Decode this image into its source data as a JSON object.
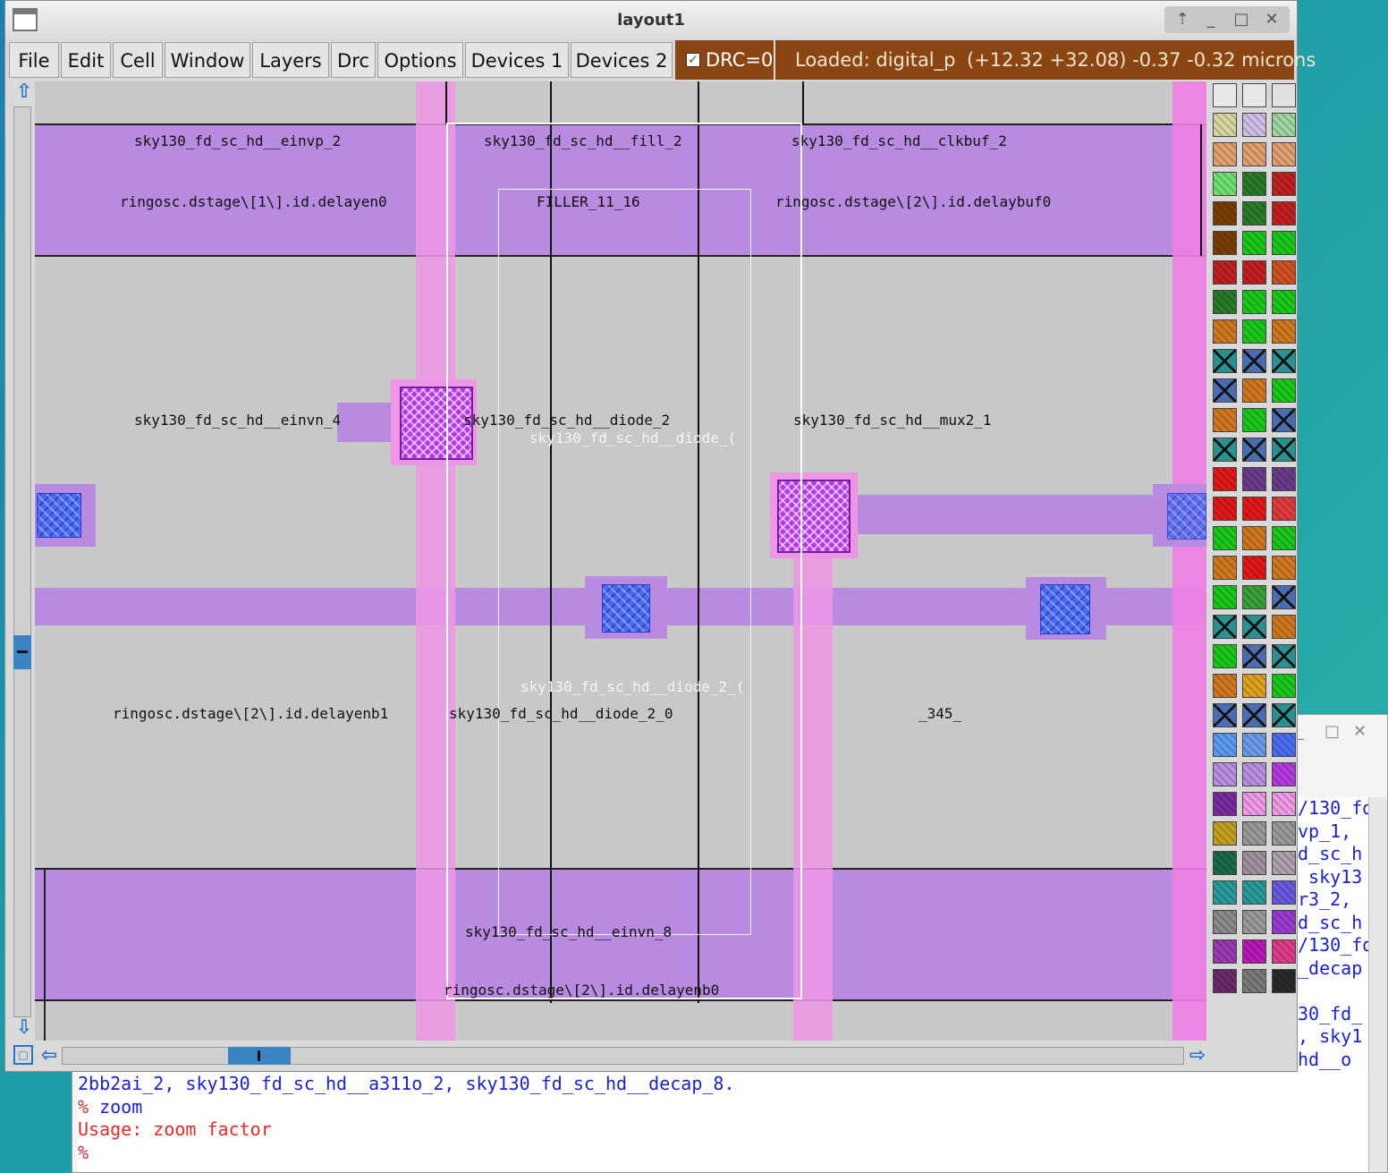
{
  "window": {
    "title": "layout1"
  },
  "menu": [
    "File",
    "Edit",
    "Cell",
    "Window",
    "Layers",
    "Drc",
    "Options",
    "Devices 1",
    "Devices 2"
  ],
  "drc": {
    "label": "DRC=0",
    "checked": true
  },
  "status": {
    "loaded": "Loaded: digital_p",
    "coords": "(+12.32 +32.08) -0.37 -0.32 microns"
  },
  "cells": [
    "sky130_fd_sc_hd__einvp_2",
    "sky130_fd_sc_hd__fill_2",
    "sky130_fd_sc_hd__clkbuf_2",
    "ringosc.dstage\\[1\\].id.delayen0",
    "FILLER_11_16",
    "ringosc.dstage\\[2\\].id.delaybuf0",
    "sky130_fd_sc_hd__einvn_4",
    "sky130_fd_sc_hd__diode_2",
    "sky130_fd_sc_hd__mux2_1",
    "ringosc.dstage\\[2\\].id.delayenb1",
    "sky130_fd_sc_hd__diode_2_0",
    "_345_",
    "sky130_fd_sc_hd__einvn_8",
    "ringosc.dstage\\[2\\].id.delayenb0"
  ],
  "cells_faint": [
    "sky130_fd_sc_hd__diode_(",
    "sky130_fd_sc_hd__diode_2_("
  ],
  "console": {
    "lines": [
      {
        "text": "2bb2ai_2, sky130_fd_sc_hd__a311o_2, sky130_fd_sc_hd__decap_8.",
        "type": "output"
      },
      {
        "prompt": "%",
        "text": " zoom",
        "type": "command"
      },
      {
        "text": "Usage: zoom factor",
        "type": "error"
      },
      {
        "prompt": "%",
        "text": "",
        "type": "command"
      }
    ],
    "side_lines": [
      "/130_fd",
      "vp_1,",
      "d_sc_h",
      " sky13",
      "r3_2,",
      "d_sc_h",
      "/130_fd",
      "_decap",
      "",
      "30_fd_",
      ", sky1",
      "hd__o"
    ]
  },
  "palette_colors": {
    "rows": [
      [
        "#e8e8e8",
        "#e8e8e8",
        "#e0e0e0"
      ],
      [
        "#d6d6a0",
        "#d0c0e8",
        "#9ed89e"
      ],
      [
        "#e0a070",
        "#e0a070",
        "#e0a070"
      ],
      [
        "#6fe06f",
        "#2a7a2a",
        "#c02020"
      ],
      [
        "#7a3d00",
        "#2a7a2a",
        "#c02020"
      ],
      [
        "#7a3d00",
        "#1ac81a",
        "#1ac81a"
      ],
      [
        "#c02020",
        "#c02020",
        "#d05020"
      ],
      [
        "#2a7a2a",
        "#1ac81a",
        "#1ac81a"
      ],
      [
        "#d07820",
        "#1ac81a",
        "#d07820"
      ],
      [
        "#2a9090",
        "#4a6cb0",
        "#2a9090"
      ],
      [
        "#4a6cb0",
        "#d07820",
        "#1ac81a"
      ],
      [
        "#d07820",
        "#1ac81a",
        "#4a6cb0"
      ],
      [
        "#2a9090",
        "#4a6cb0",
        "#2a9090"
      ],
      [
        "#e01818",
        "#6a3a8a",
        "#6a3a8a"
      ],
      [
        "#e01818",
        "#e01818",
        "#e03a3a"
      ],
      [
        "#1ac81a",
        "#d07820",
        "#1ac81a"
      ],
      [
        "#d07820",
        "#e01818",
        "#d07820"
      ],
      [
        "#1ac81a",
        "#3aa03a",
        "#4a6cb0"
      ],
      [
        "#2a9090",
        "#2a9090",
        "#d07820"
      ],
      [
        "#1ac81a",
        "#4a6cb0",
        "#2a9090"
      ],
      [
        "#d07820",
        "#e0a020",
        "#1ac81a"
      ],
      [
        "#4a6cb0",
        "#4a6cb0",
        "#2a9090"
      ],
      [
        "#5a9af0",
        "#6a9ae8",
        "#4a6cf0"
      ],
      [
        "#b890e0",
        "#b890e0",
        "#b43ae0"
      ],
      [
        "#7a2aa0",
        "#f09ae8",
        "#f09ae8"
      ],
      [
        "#c0a020",
        "#9a9a9a",
        "#9a9a9a"
      ],
      [
        "#1a6a4a",
        "#a090a0",
        "#b0a0b0"
      ],
      [
        "#2a9a9a",
        "#2a9a9a",
        "#6a5ae0"
      ],
      [
        "#8a8a8a",
        "#9a9a9a",
        "#9a3ad0"
      ],
      [
        "#9a3ab0",
        "#b818b8",
        "#e03a8a"
      ],
      [
        "#6a2a6a",
        "#7a7a7a",
        "#2a2a2a"
      ]
    ]
  }
}
